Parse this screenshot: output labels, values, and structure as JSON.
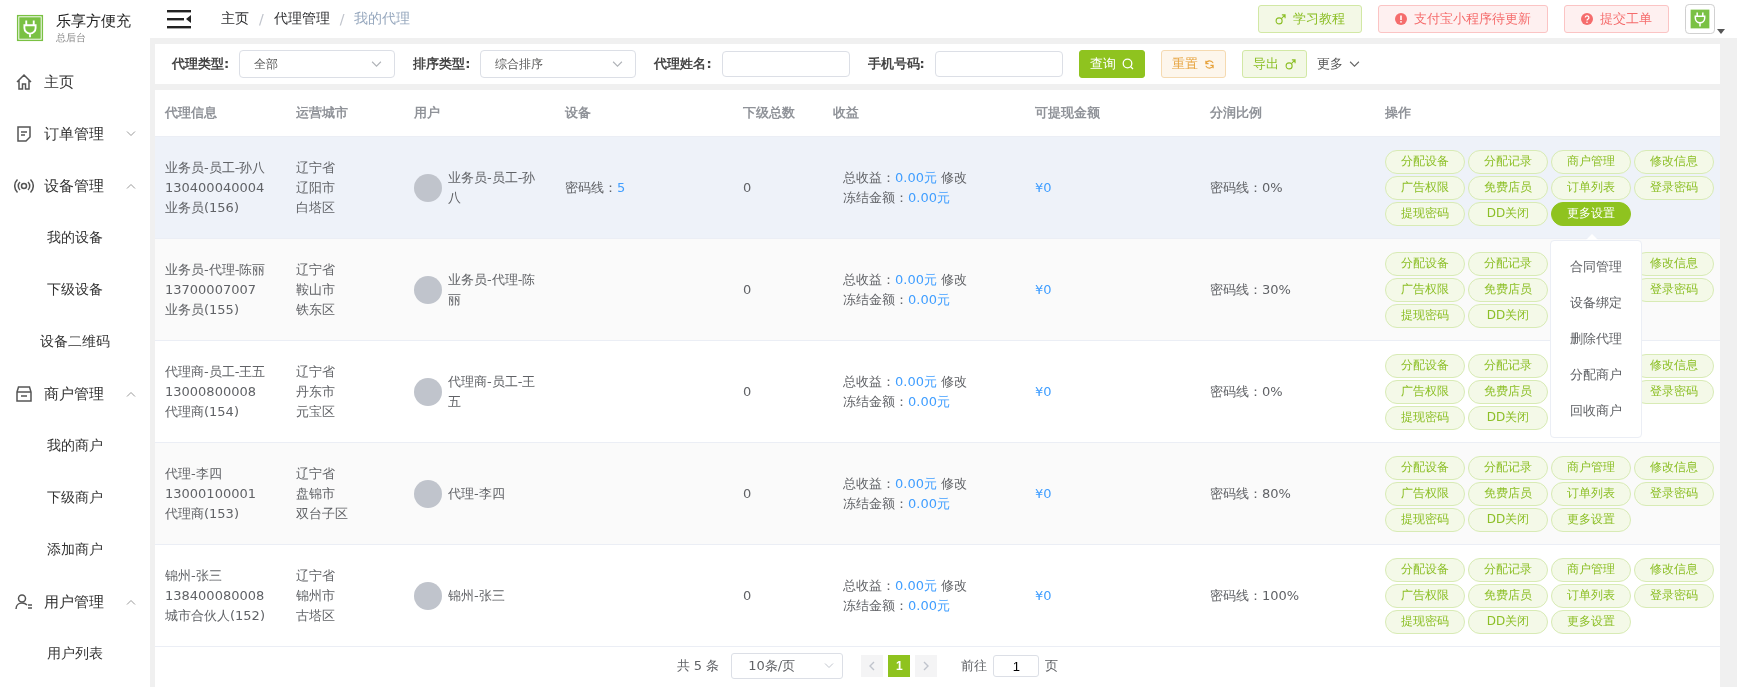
{
  "sidebar": {
    "brand": "乐享方便充",
    "subtitle": "总后台",
    "items": [
      {
        "label": "主页"
      },
      {
        "label": "订单管理",
        "expanded": false
      },
      {
        "label": "设备管理",
        "expanded": true,
        "children": [
          {
            "label": "我的设备"
          },
          {
            "label": "下级设备"
          },
          {
            "label": "设备二维码"
          }
        ]
      },
      {
        "label": "商户管理",
        "expanded": true,
        "children": [
          {
            "label": "我的商户"
          },
          {
            "label": "下级商户"
          },
          {
            "label": "添加商户"
          }
        ]
      },
      {
        "label": "用户管理",
        "expanded": true,
        "children": [
          {
            "label": "用户列表"
          }
        ]
      }
    ]
  },
  "breadcrumb": {
    "separator": "/",
    "items": [
      {
        "label": "主页",
        "current": false
      },
      {
        "label": "代理管理",
        "current": false
      },
      {
        "label": "我的代理",
        "current": true
      }
    ]
  },
  "header_buttons": [
    {
      "label": "学习教程",
      "kind": "tutorial"
    },
    {
      "label": "支付宝小程序待更新",
      "kind": "warning"
    },
    {
      "label": "提交工单",
      "kind": "help"
    }
  ],
  "filters": [
    {
      "label": "代理类型:",
      "kind": "select",
      "value": "全部"
    },
    {
      "label": "排序类型:",
      "kind": "select",
      "value": "综合排序"
    },
    {
      "label": "代理姓名:",
      "kind": "input"
    },
    {
      "label": "手机号码:",
      "kind": "input"
    }
  ],
  "filter_buttons": [
    {
      "label": "查询",
      "kind": "search"
    },
    {
      "label": "重置",
      "kind": "reset"
    },
    {
      "label": "导出",
      "kind": "export"
    }
  ],
  "more_filters": {
    "label": "更多",
    "expanded": false
  },
  "table": {
    "columns": [
      "代理信息",
      "运营城市",
      "用户",
      "设备",
      "下级总数",
      "收益",
      "可提现金额",
      "分润比例",
      "操作"
    ],
    "rows": [
      {
        "hovered": true,
        "info": [
          "业务员-员工-孙八",
          "130400040004",
          "业务员(156)"
        ],
        "city": [
          "辽宁省",
          "辽阳市",
          "白塔区"
        ],
        "user": "业务员-员工-孙八",
        "device": {
          "label": "密码线：",
          "value": "5"
        },
        "subordinates": "0",
        "income": {
          "total_label": "总收益：",
          "total": "0.00元",
          "edit": "修改",
          "frozen_label": "冻结金额：",
          "frozen": "0.00元"
        },
        "withdrawable": "¥0",
        "share": "密码线：0%",
        "actions": [
          [
            "分配设备",
            "分配记录",
            "商户管理",
            "修改信息"
          ],
          [
            "广告权限",
            "免费店员",
            "订单列表",
            "登录密码"
          ],
          [
            "提现密码",
            "DD关闭"
          ]
        ],
        "more": {
          "label": "更多设置",
          "active": true
        }
      },
      {
        "hovered": false,
        "info": [
          "业务员-代理-陈丽",
          "13700007007",
          "业务员(155)"
        ],
        "city": [
          "辽宁省",
          "鞍山市",
          "铁东区"
        ],
        "user": "业务员-代理-陈丽",
        "subordinates": "0",
        "income": {
          "total_label": "总收益：",
          "total": "0.00元",
          "edit": "修改",
          "frozen_label": "冻结金额：",
          "frozen": "0.00元"
        },
        "withdrawable": "¥0",
        "share": "密码线：30%",
        "actions": [
          [
            "分配设备",
            "分配记录",
            "修改信息"
          ],
          [
            "广告权限",
            "免费店员",
            "登录密码"
          ],
          [
            "提现密码",
            "DD关闭"
          ]
        ]
      },
      {
        "hovered": false,
        "info": [
          "代理商-员工-王五",
          "13000800008",
          "代理商(154)"
        ],
        "city": [
          "辽宁省",
          "丹东市",
          "元宝区"
        ],
        "user": "代理商-员工-王五",
        "subordinates": "0",
        "income": {
          "total_label": "总收益：",
          "total": "0.00元",
          "edit": "修改",
          "frozen_label": "冻结金额：",
          "frozen": "0.00元"
        },
        "withdrawable": "¥0",
        "share": "密码线：0%",
        "actions": [
          [
            "分配设备",
            "分配记录",
            "修改信息"
          ],
          [
            "广告权限",
            "免费店员",
            "登录密码"
          ],
          [
            "提现密码",
            "DD关闭"
          ]
        ]
      },
      {
        "hovered": false,
        "info": [
          "代理-李四",
          "13000100001",
          "代理商(153)"
        ],
        "city": [
          "辽宁省",
          "盘锦市",
          "双台子区"
        ],
        "user": "代理-李四",
        "subordinates": "0",
        "income": {
          "total_label": "总收益：",
          "total": "0.00元",
          "edit": "修改",
          "frozen_label": "冻结金额：",
          "frozen": "0.00元"
        },
        "withdrawable": "¥0",
        "share": "密码线：80%",
        "actions": [
          [
            "分配设备",
            "分配记录",
            "商户管理",
            "修改信息"
          ],
          [
            "广告权限",
            "免费店员",
            "订单列表",
            "登录密码"
          ],
          [
            "提现密码",
            "DD关闭"
          ]
        ],
        "more": {
          "label": "更多设置",
          "active": false
        }
      },
      {
        "hovered": false,
        "info": [
          "锦州-张三",
          "138400080008",
          "城市合伙人(152)"
        ],
        "city": [
          "辽宁省",
          "锦州市",
          "古塔区"
        ],
        "user": "锦州-张三",
        "subordinates": "0",
        "income": {
          "total_label": "总收益：",
          "total": "0.00元",
          "edit": "修改",
          "frozen_label": "冻结金额：",
          "frozen": "0.00元"
        },
        "withdrawable": "¥0",
        "share": "密码线：100%",
        "actions": [
          [
            "分配设备",
            "分配记录",
            "商户管理",
            "修改信息"
          ],
          [
            "广告权限",
            "免费店员",
            "订单列表",
            "登录密码"
          ],
          [
            "提现密码",
            "DD关闭"
          ]
        ],
        "more": {
          "label": "更多设置",
          "active": false
        }
      }
    ]
  },
  "more_menu": {
    "items": [
      "合同管理",
      "设备绑定",
      "删除代理",
      "分配商户",
      "回收商户"
    ]
  },
  "pagination": {
    "total": "共 5 条",
    "page_size": "10条/页",
    "pages": [
      {
        "label": "1",
        "selected": true
      }
    ],
    "goto_label": "前往",
    "goto_value": "1",
    "goto_suffix": "页"
  }
}
